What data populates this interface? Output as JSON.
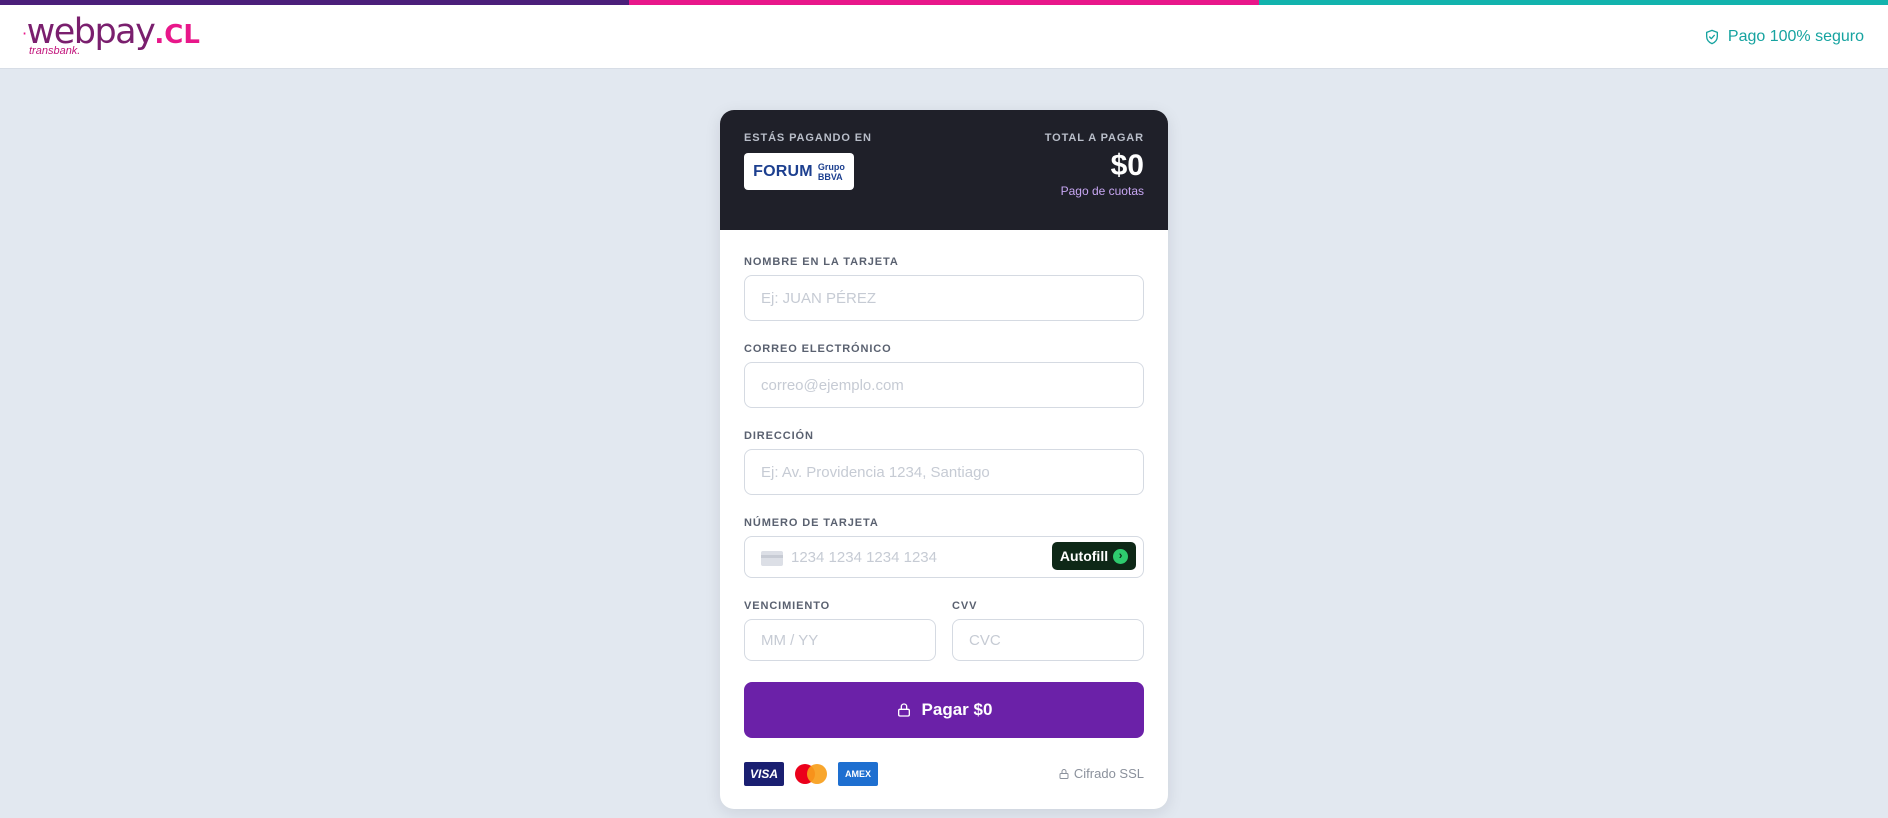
{
  "header": {
    "logo_text": "webpay",
    "logo_suffix": ".CL",
    "logo_sub": "transbank.",
    "secure_label": "Pago 100% seguro",
    "stripe_colors": [
      "#4b1f7a",
      "#e8178a",
      "#12b3ad"
    ]
  },
  "summary": {
    "paying_at_label": "ESTÁS PAGANDO EN",
    "merchant_name": "FORUM",
    "merchant_group_line1": "Grupo",
    "merchant_group_line2": "BBVA",
    "total_label": "TOTAL A PAGAR",
    "total_amount": "$0",
    "payment_type": "Pago de cuotas"
  },
  "form": {
    "name_label": "NOMBRE EN LA TARJETA",
    "name_placeholder": "Ej: JUAN PÉREZ",
    "email_label": "CORREO ELECTRÓNICO",
    "email_placeholder": "correo@ejemplo.com",
    "address_label": "DIRECCIÓN",
    "address_placeholder": "Ej: Av. Providencia 1234, Santiago",
    "card_label": "NÚMERO DE TARJETA",
    "card_placeholder": "1234 1234 1234 1234",
    "autofill_label": "Autofill",
    "expiry_label": "VENCIMIENTO",
    "expiry_placeholder": "MM / YY",
    "cvv_label": "CVV",
    "cvv_placeholder": "CVC",
    "pay_button_label": "Pagar $0"
  },
  "footer": {
    "brands": [
      "VISA",
      "mastercard",
      "AMEX"
    ],
    "ssl_label": "Cifrado SSL"
  },
  "colors": {
    "accent": "#6b21a8",
    "secure": "#16a3a0",
    "header_dark": "#1f2029",
    "autofill_bg": "#0e2817"
  }
}
